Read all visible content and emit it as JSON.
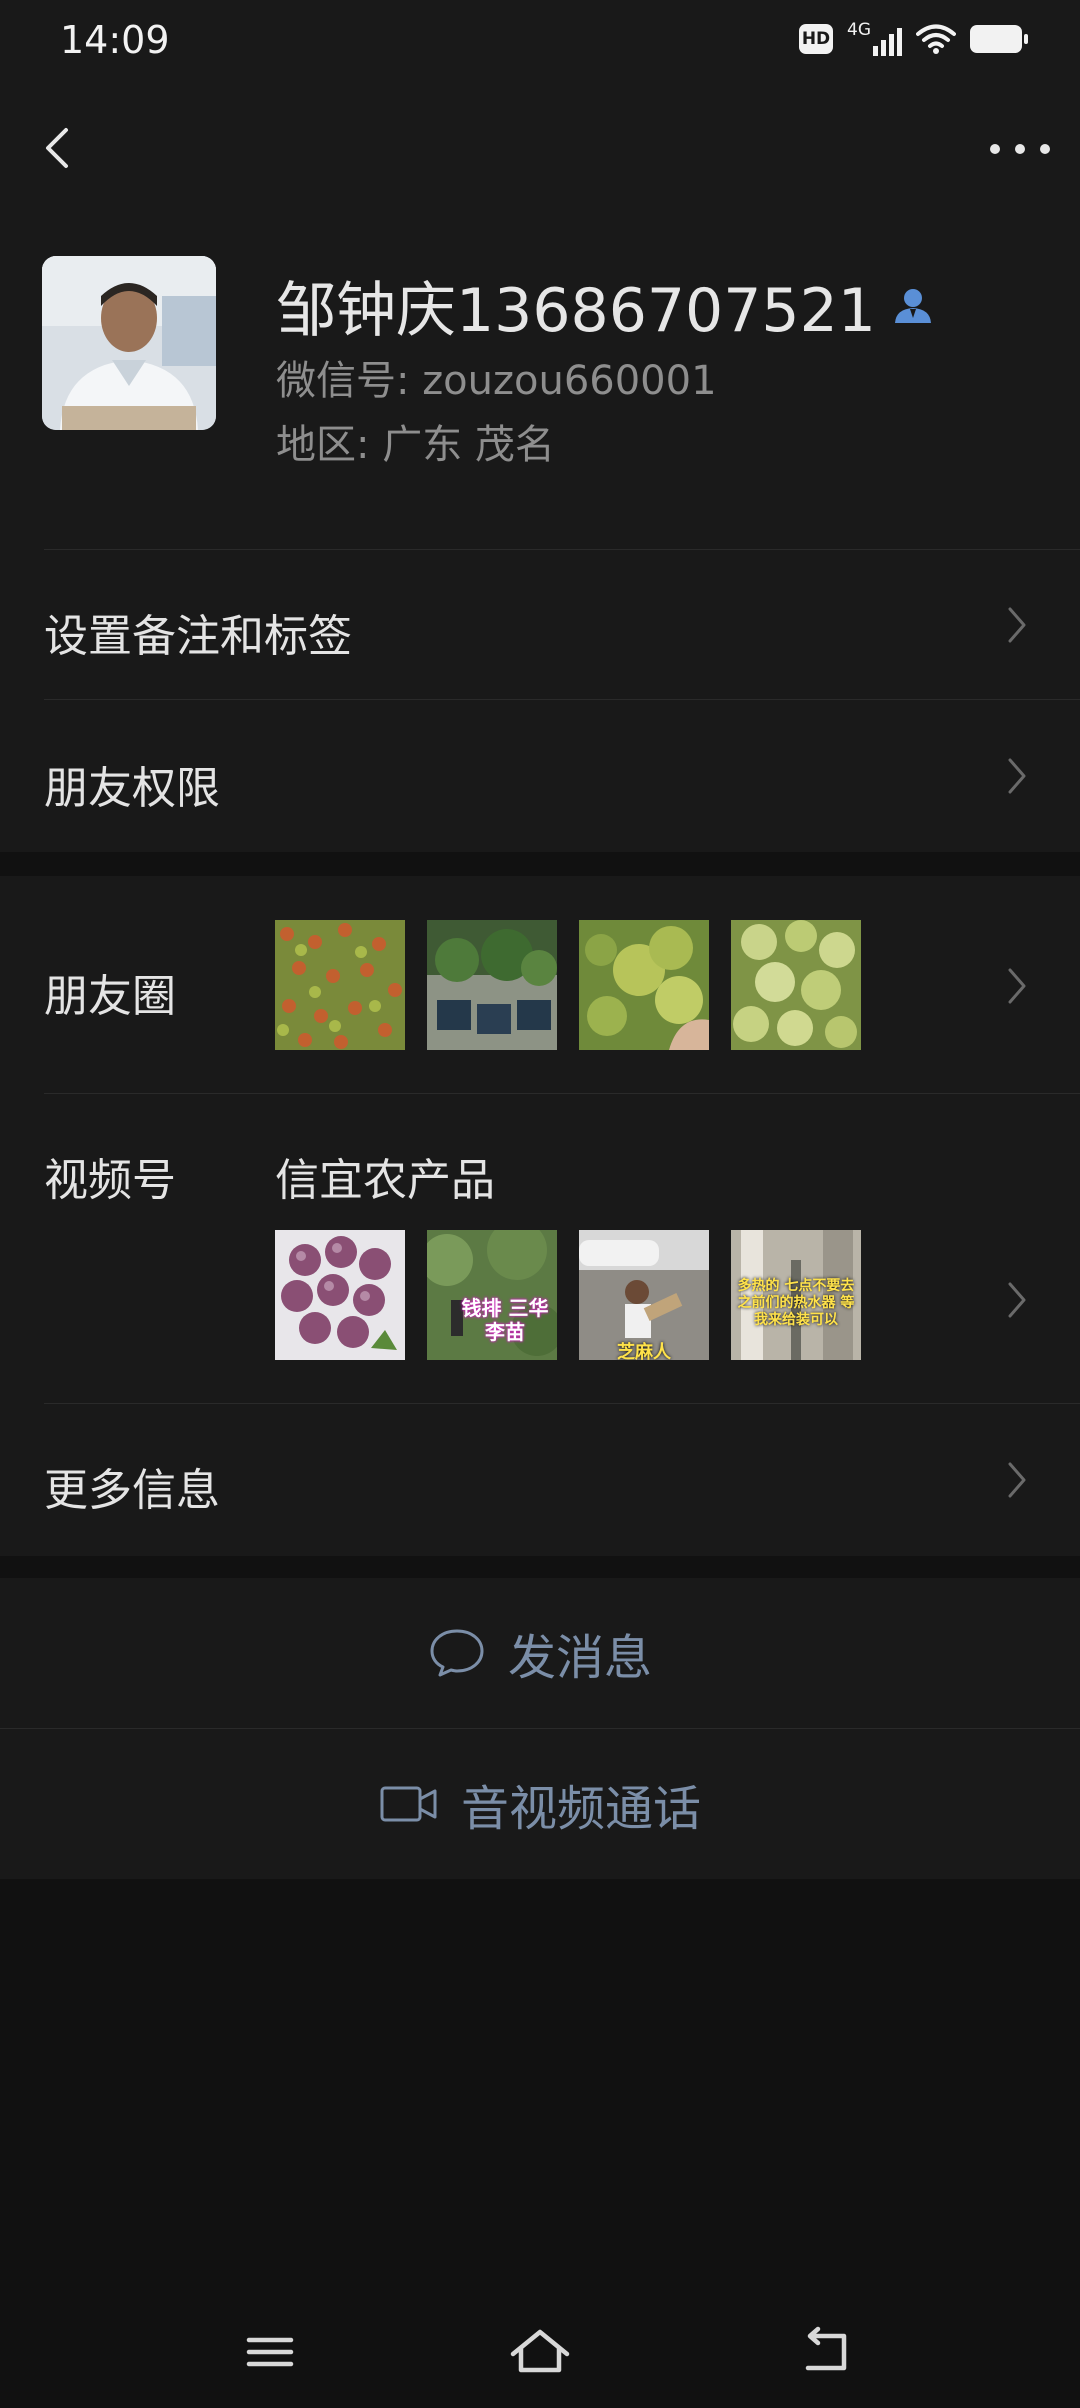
{
  "status_bar": {
    "time": "14:09",
    "hd": "HD",
    "network": "4G"
  },
  "profile": {
    "name": "邹钟庆13686707521",
    "wechat_id": "微信号: zouzou660001",
    "region": "地区: 广东  茂名"
  },
  "rows": {
    "remark_tags": "设置备注和标签",
    "friend_permissions": "朋友权限",
    "moments": "朋友圈",
    "channels": "视频号",
    "channels_name": "信宜农产品",
    "more_info": "更多信息"
  },
  "thumb_captions": {
    "channels_2": "钱排 三华李苗",
    "channels_3": "芝麻人",
    "channels_4": "多热的 七点不要去 之前们的热水器 等我来给装可以"
  },
  "actions": {
    "send_message": "发消息",
    "av_call": "音视频通话"
  },
  "icons": {
    "back": "chevron-left-icon",
    "more": "more-dots-icon",
    "person": "person-icon",
    "chevron": "chevron-right-icon",
    "chat": "chat-bubble-icon",
    "video": "video-camera-icon",
    "nav_menu": "menu-icon",
    "nav_home": "home-icon",
    "nav_back": "back-icon"
  },
  "colors": {
    "background": "#111111",
    "surface": "#191919",
    "accent": "#7b8ea8",
    "person_icon": "#5a8fd6"
  }
}
